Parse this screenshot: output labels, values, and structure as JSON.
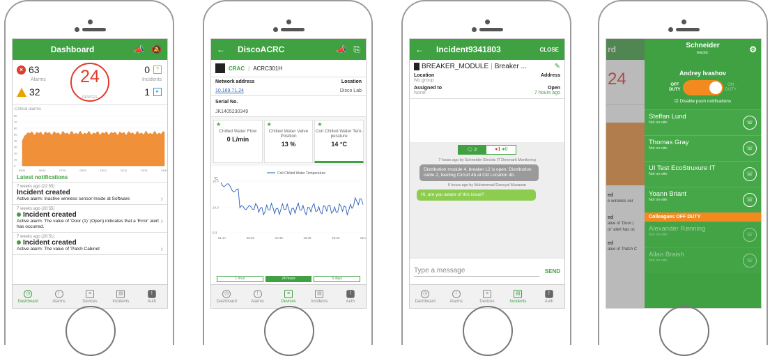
{
  "p1": {
    "title": "Dashboard",
    "alarms_count": "63",
    "alarms_label": "Alarms",
    "warn_count": "32",
    "devices_count": "24",
    "devices_label": "DEVICES",
    "incidents_open": "0",
    "incidents_label": "Incidents",
    "incidents_ack": "1",
    "critical_label": "Critical alarms",
    "y_ticks": [
      "80",
      "70",
      "60",
      "50",
      "40",
      "30",
      "20",
      "10",
      "0"
    ],
    "x_ticks": [
      "05/11",
      "06/11",
      "07/11",
      "08/11",
      "10/11",
      "11/11",
      "12/11",
      "14/11"
    ],
    "latest": "Latest notifications",
    "notifications": [
      {
        "time": "7 weeks ago (22:55)",
        "head": "Incident created",
        "body": "Active alarm: Inactive wireless sensor Inside at Software"
      },
      {
        "time": "7 weeks ago (20:55)",
        "head": "Incident created",
        "body": "Active alarm: The value of 'Door (1)' (Open) indicates that a 'Error' alert has occurred."
      },
      {
        "time": "7 weeks ago (20:51)",
        "head": "Incident created",
        "body": "Active alarm: The value of 'Patch Cabinet"
      }
    ]
  },
  "tabs": {
    "dashboard": "Dashboard",
    "alarms": "Alarms",
    "devices": "Devices",
    "incidents": "Incidents",
    "auth": "Auth"
  },
  "p2": {
    "title": "DiscoACRC",
    "dev_type": "CRAC",
    "dev_id": "ACRC301H",
    "net_label": "Network address",
    "loc_label": "Location",
    "ip": "10.169.71.24",
    "loc": "Disco Lab",
    "serial_label": "Serial No.",
    "serial": "JK1405230349",
    "cards": [
      {
        "name": "Chilled Water Flow",
        "value": "0 L/min"
      },
      {
        "name": "Chilled Water Valve Position",
        "value": "13 %"
      },
      {
        "name": "Coil Chilled Water Tem-perature",
        "value": "14 °C"
      }
    ],
    "legend": "Coil Chilled Water Temperature",
    "unit": "°C",
    "y_ticks": [
      "15.4",
      "14.3",
      "9.3"
    ],
    "x_ticks": [
      "01:17",
      "06:03",
      "10:46",
      "15:36",
      "20:22",
      "01:08"
    ],
    "ranges": [
      "1 hour",
      "24 hours",
      "5 days"
    ]
  },
  "p3": {
    "title": "Incident9341803",
    "close": "CLOSE",
    "head": "BREAKER_MODULE",
    "head2": "Breaker ...",
    "location_label": "Location",
    "location_val": "No group",
    "address_label": "Address",
    "address_val": "-",
    "assigned_label": "Assigned to",
    "assigned_val": "None",
    "status": "Open",
    "status_time": "7 hours ago",
    "chat_count": "2",
    "red_count": "1",
    "green_count": "0",
    "meta1": "7 hours ago by Schneider Electric IT Denmark Monitoring",
    "msg1": "Distribution module 4, breaker L2 is open. Distribution cable 2, feeding Circuit 4b at Ckt Location 4b.",
    "meta2": "6 hours ago by Muhammad Daneyal Musawar",
    "msg2": "Hi, are you aware of this issue?",
    "placeholder": "Type a message",
    "send": "SEND"
  },
  "p4": {
    "brand": "Schneider",
    "brand2": "Electric",
    "user": "Andrey Ivashov",
    "off": "OFF",
    "off2": "DUTY",
    "on": "ON",
    "on2": "DUTY",
    "disable": "Disable push notifications",
    "on_duty": [
      {
        "name": "Steffan Lund",
        "status": "Not on-site"
      },
      {
        "name": "Thomas Gray",
        "status": "Not on-site"
      },
      {
        "name": "UI Test EcoStruxure IT",
        "status": "Not on-site"
      },
      {
        "name": "Yoann Briant",
        "status": "Not on-site"
      }
    ],
    "section": "Colleagues OFF DUTY",
    "off_duty": [
      {
        "name": "Alexander Rønning",
        "status": "Not on-site"
      },
      {
        "name": "Allan Braish",
        "status": "Not on-site"
      }
    ],
    "bg_title": "rd",
    "bg_count": "24",
    "bg_lines": [
      "ed",
      "e wireless ser",
      "ed",
      "alue of 'Door (",
      "or' alert has oc",
      "ed",
      "alue of 'Patch C"
    ]
  }
}
